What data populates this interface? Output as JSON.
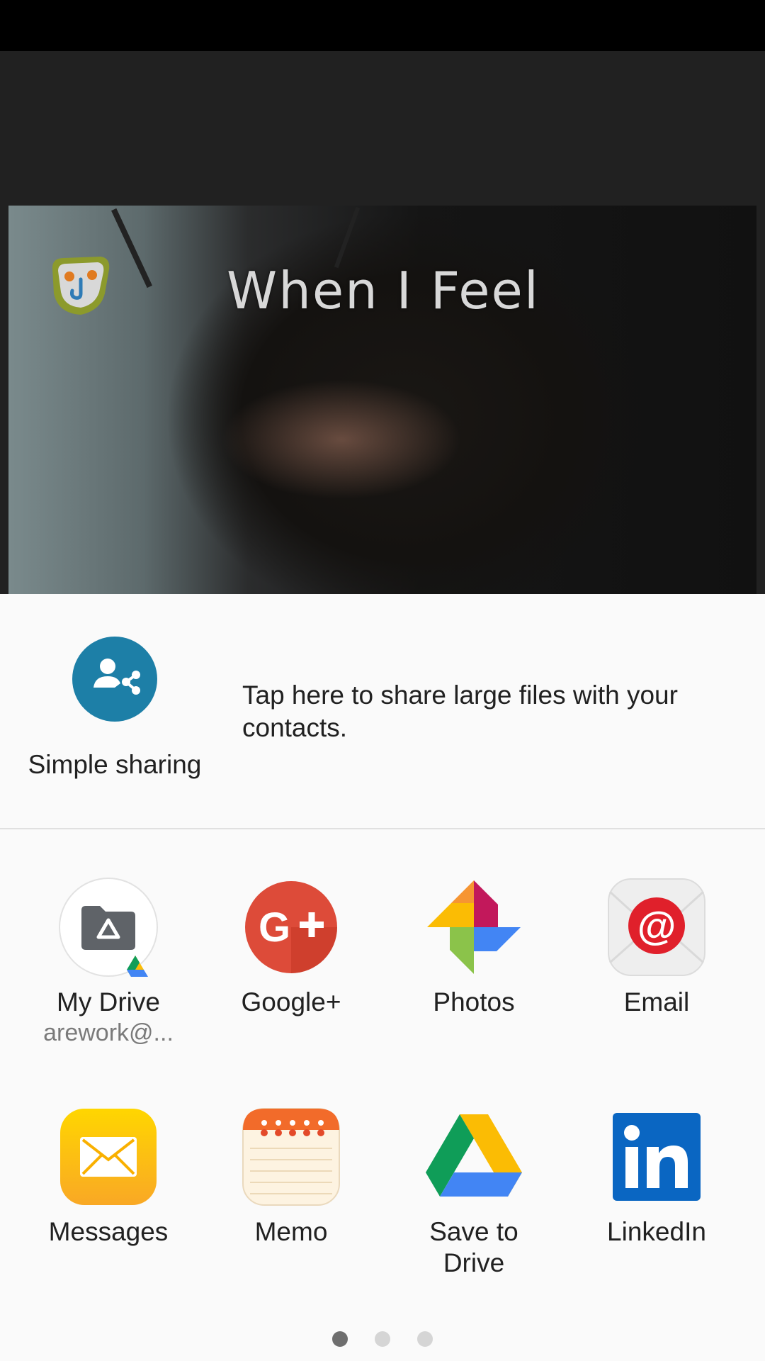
{
  "preview": {
    "caption": "When I Feel"
  },
  "simple_sharing": {
    "label": "Simple sharing",
    "description": "Tap here to share large files with your contacts.",
    "icon": "simple-sharing-icon",
    "color": "#1d7fa7"
  },
  "apps": [
    {
      "label": "My Drive",
      "sub": "arework@...",
      "icon": "my-drive-icon"
    },
    {
      "label": "Google+",
      "sub": "",
      "icon": "google-plus-icon",
      "color": "#dd4b39"
    },
    {
      "label": "Photos",
      "sub": "",
      "icon": "photos-icon"
    },
    {
      "label": "Email",
      "sub": "",
      "icon": "email-icon",
      "color": "#e0202b"
    },
    {
      "label": "Messages",
      "sub": "",
      "icon": "messages-icon",
      "color": "#fbc02d"
    },
    {
      "label": "Memo",
      "sub": "",
      "icon": "memo-icon",
      "color": "#f26b2a"
    },
    {
      "label": "Save to Drive",
      "sub": "",
      "icon": "save-to-drive-icon"
    },
    {
      "label": "LinkedIn",
      "sub": "",
      "icon": "linkedin-icon",
      "color": "#0a66c2"
    }
  ],
  "pagination": {
    "pages": 3,
    "current": 1
  }
}
